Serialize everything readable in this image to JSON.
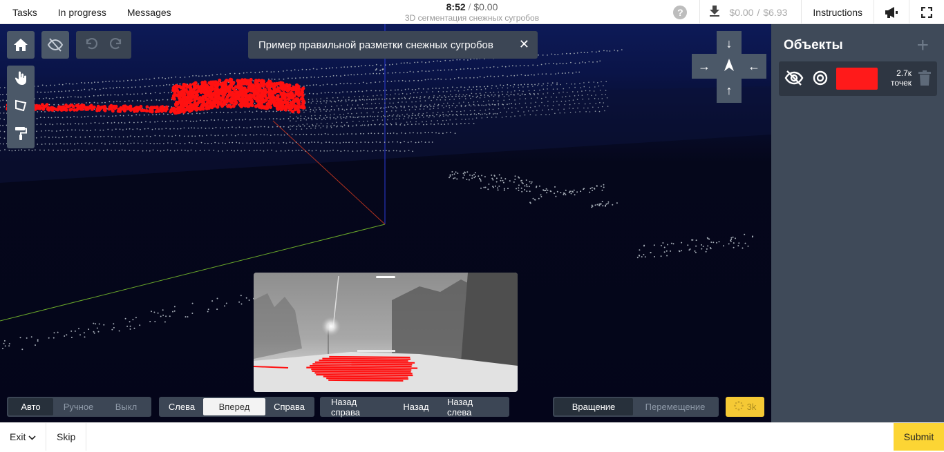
{
  "topbar": {
    "nav": [
      "Tasks",
      "In progress",
      "Messages"
    ],
    "timer": "8:52",
    "separator": "/",
    "earnings": "$0.00",
    "task_title": "3D сегментация снежных сугробов",
    "help_label": "?",
    "balance_current": "$0.00",
    "balance_separator": "/",
    "balance_total": "$6.93",
    "instructions_label": "Instructions"
  },
  "viewport": {
    "banner_text": "Пример правильной разметки снежных сугробов",
    "banner_close": "✕",
    "camera_mode": {
      "options": [
        "Авто",
        "Ручное",
        "Выкл"
      ],
      "selected": "Авто"
    },
    "view_direction": {
      "options": [
        "Слева",
        "Вперед",
        "Справа"
      ],
      "selected": "Вперед"
    },
    "view_back": {
      "options": [
        "Назад справа",
        "Назад",
        "Назад слева"
      ]
    },
    "interaction_mode": {
      "options": [
        "Вращение",
        "Перемещение"
      ],
      "selected": "Вращение"
    },
    "points_badge": "3k"
  },
  "objects_panel": {
    "title": "Объекты",
    "add_label": "+",
    "items": [
      {
        "color": "#ff1a1a",
        "count": "2.7к",
        "unit": "точек"
      }
    ]
  },
  "bottombar": {
    "exit_label": "Exit",
    "skip_label": "Skip",
    "submit_label": "Submit"
  }
}
